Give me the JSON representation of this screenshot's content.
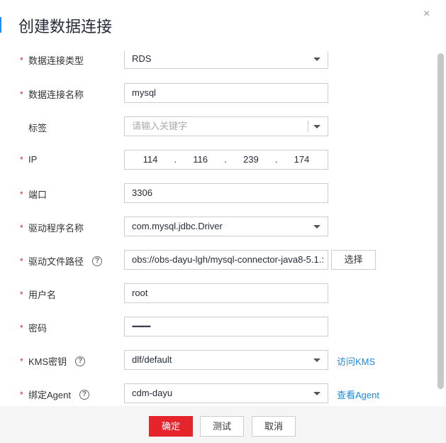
{
  "dialog": {
    "title": "创建数据连接",
    "close": "×"
  },
  "fields": {
    "type": {
      "label": "数据连接类型",
      "value": "RDS"
    },
    "name": {
      "label": "数据连接名称",
      "value": "mysql"
    },
    "tag": {
      "label": "标签",
      "placeholder": "请输入关键字"
    },
    "ip": {
      "label": "IP",
      "octets": [
        "114",
        "116",
        "239",
        "174"
      ],
      "dot": "."
    },
    "port": {
      "label": "端口",
      "value": "3306"
    },
    "driver": {
      "label": "驱动程序名称",
      "value": "com.mysql.jdbc.Driver"
    },
    "driver_path": {
      "label": "驱动文件路径",
      "value": "obs://obs-dayu-lgh/mysql-connector-java8-5.1.:",
      "button": "选择"
    },
    "username": {
      "label": "用户名",
      "value": "root"
    },
    "password": {
      "label": "密码",
      "value": "••••••••••••"
    },
    "kms": {
      "label": "KMS密钥",
      "value": "dlf/default",
      "link": "访问KMS"
    },
    "agent": {
      "label": "绑定Agent",
      "value": "cdm-dayu",
      "link": "查看Agent"
    }
  },
  "required_mark": "*",
  "help_icon": "?",
  "footer": {
    "ok": "确定",
    "test": "测试",
    "cancel": "取消"
  }
}
